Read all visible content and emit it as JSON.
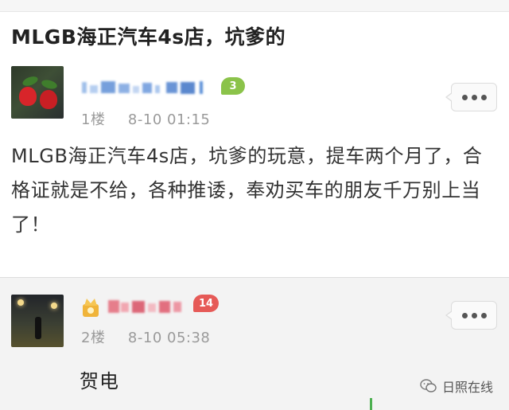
{
  "post": {
    "title": "MLGB海正汽车4s店，坑爹的",
    "floor": "1楼",
    "date": "8-10 01:15",
    "user_level": "3",
    "content": "MLGB海正汽车4s店，坑爹的玩意，提车两个月了，合格证就是不给，各种推诿，奉劝买车的朋友千万别上当了！"
  },
  "reply": {
    "floor": "2楼",
    "date": "8-10 05:38",
    "user_level": "14",
    "content": "贺电"
  },
  "watermark": {
    "text": "日照在线"
  },
  "colors": {
    "username": "#3c7bd0",
    "badge_green": "#8bc34a",
    "badge_red": "#e65a57",
    "meta": "#9a9a9a"
  },
  "icons": {
    "more": "more-dots-icon",
    "vip": "vip-crown-icon",
    "watermark": "wechat-icon"
  }
}
